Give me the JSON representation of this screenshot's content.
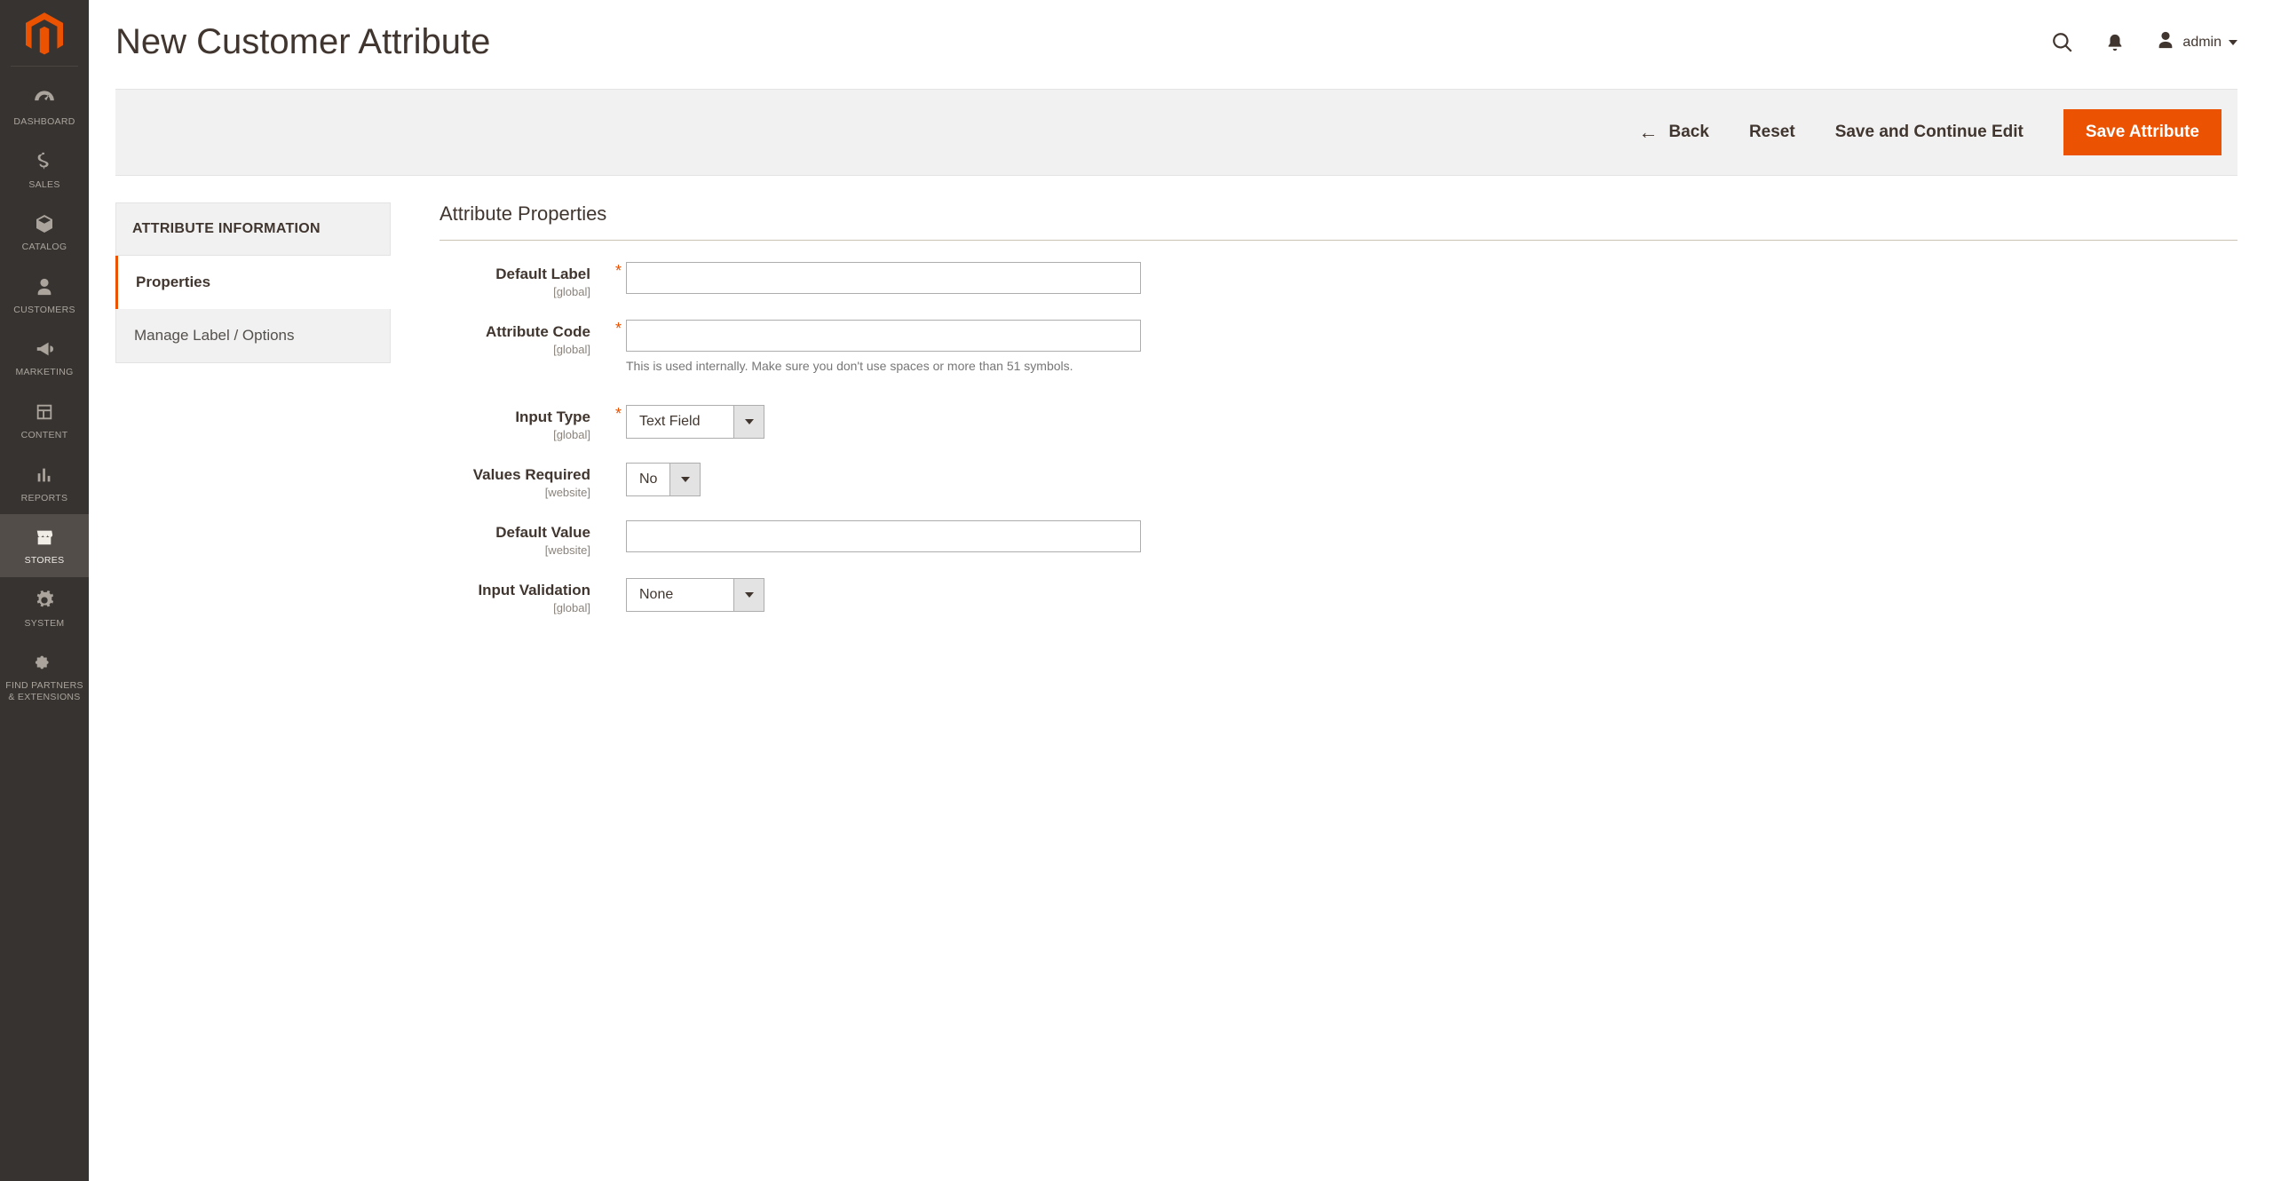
{
  "sidebar": {
    "items": [
      {
        "label": "DASHBOARD"
      },
      {
        "label": "SALES"
      },
      {
        "label": "CATALOG"
      },
      {
        "label": "CUSTOMERS"
      },
      {
        "label": "MARKETING"
      },
      {
        "label": "CONTENT"
      },
      {
        "label": "REPORTS"
      },
      {
        "label": "STORES"
      },
      {
        "label": "SYSTEM"
      },
      {
        "label": "FIND PARTNERS & EXTENSIONS"
      }
    ]
  },
  "header": {
    "title": "New Customer Attribute",
    "user_label": "admin"
  },
  "actions": {
    "back": "Back",
    "reset": "Reset",
    "save_continue": "Save and Continue Edit",
    "save": "Save Attribute"
  },
  "side_panel": {
    "header": "ATTRIBUTE INFORMATION",
    "tabs": [
      {
        "label": "Properties"
      },
      {
        "label": "Manage Label / Options"
      }
    ]
  },
  "form": {
    "section_title": "Attribute Properties",
    "default_label": {
      "label": "Default Label",
      "scope": "[global]",
      "value": ""
    },
    "attribute_code": {
      "label": "Attribute Code",
      "scope": "[global]",
      "value": "",
      "note": "This is used internally. Make sure you don't use spaces or more than 51 symbols."
    },
    "input_type": {
      "label": "Input Type",
      "scope": "[global]",
      "value": "Text Field"
    },
    "values_required": {
      "label": "Values Required",
      "scope": "[website]",
      "value": "No"
    },
    "default_value": {
      "label": "Default Value",
      "scope": "[website]",
      "value": ""
    },
    "input_validation": {
      "label": "Input Validation",
      "scope": "[global]",
      "value": "None"
    }
  },
  "colors": {
    "accent": "#eb5202"
  }
}
